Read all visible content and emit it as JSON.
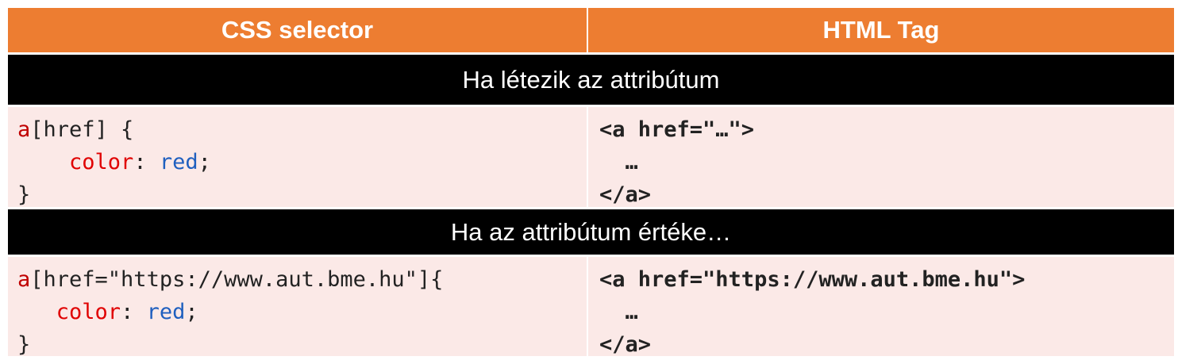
{
  "header": {
    "col1": "CSS selector",
    "col2": "HTML Tag"
  },
  "section1": {
    "title": "Ha létezik az attribútum",
    "css": {
      "selector_tag": "a",
      "selector_rest": "[href] {",
      "indent": "    ",
      "property": "color",
      "colon": ": ",
      "value": "red",
      "semicolon": ";",
      "close": "}"
    },
    "html": {
      "open_tag": "<a href=\"…\">",
      "content": "  …",
      "close_tag": "</a>"
    }
  },
  "section2": {
    "title": "Ha az attribútum értéke…",
    "css": {
      "selector_tag": "a",
      "selector_rest": "[href=\"https://www.aut.bme.hu\"]{",
      "indent": "   ",
      "property": "color",
      "colon": ": ",
      "value": "red",
      "semicolon": ";",
      "close": "}"
    },
    "html": {
      "open_tag": "<a href=\"https://www.aut.bme.hu\">",
      "content": "  …",
      "close_tag": "</a>"
    }
  }
}
